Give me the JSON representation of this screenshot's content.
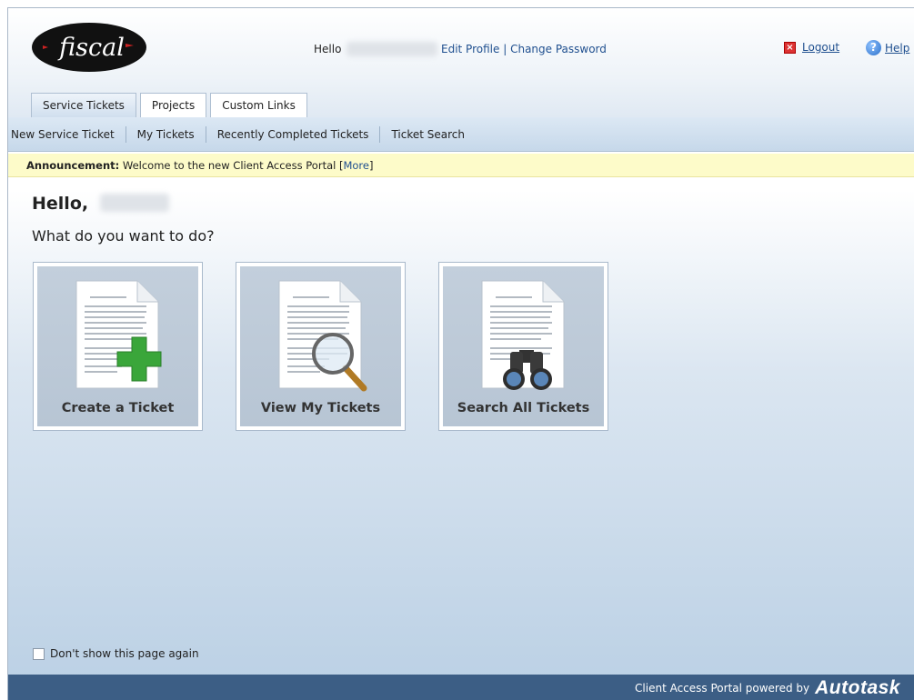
{
  "header": {
    "logo_text": "fiscal",
    "hello_label": "Hello",
    "edit_profile": "Edit Profile",
    "separator": "|",
    "change_password": "Change Password",
    "logout": "Logout",
    "help": "Help"
  },
  "tabs": [
    {
      "label": "Service Tickets",
      "active": true
    },
    {
      "label": "Projects",
      "active": false
    },
    {
      "label": "Custom Links",
      "active": false
    }
  ],
  "subnav": [
    {
      "label": "New Service Ticket"
    },
    {
      "label": "My Tickets"
    },
    {
      "label": "Recently Completed Tickets"
    },
    {
      "label": "Ticket Search"
    }
  ],
  "announcement": {
    "label": "Announcement:",
    "text": " Welcome to the new Client Access Portal [",
    "more": "More",
    "close_bracket": "]"
  },
  "main": {
    "hello": "Hello,",
    "prompt": "What do you want to do?",
    "cards": [
      {
        "label": "Create a Ticket",
        "icon": "document-plus-icon"
      },
      {
        "label": "View My Tickets",
        "icon": "document-magnifier-icon"
      },
      {
        "label": "Search All Tickets",
        "icon": "document-binoculars-icon"
      }
    ],
    "dont_show": "Don't show this page again"
  },
  "footer": {
    "text": "Client Access Portal powered by",
    "brand": "Autotask"
  },
  "colors": {
    "link": "#1f4f8f",
    "footer_bg": "#3c5e85",
    "announcement_bg": "#fdfbc9",
    "plus_green": "#3aa63a"
  }
}
